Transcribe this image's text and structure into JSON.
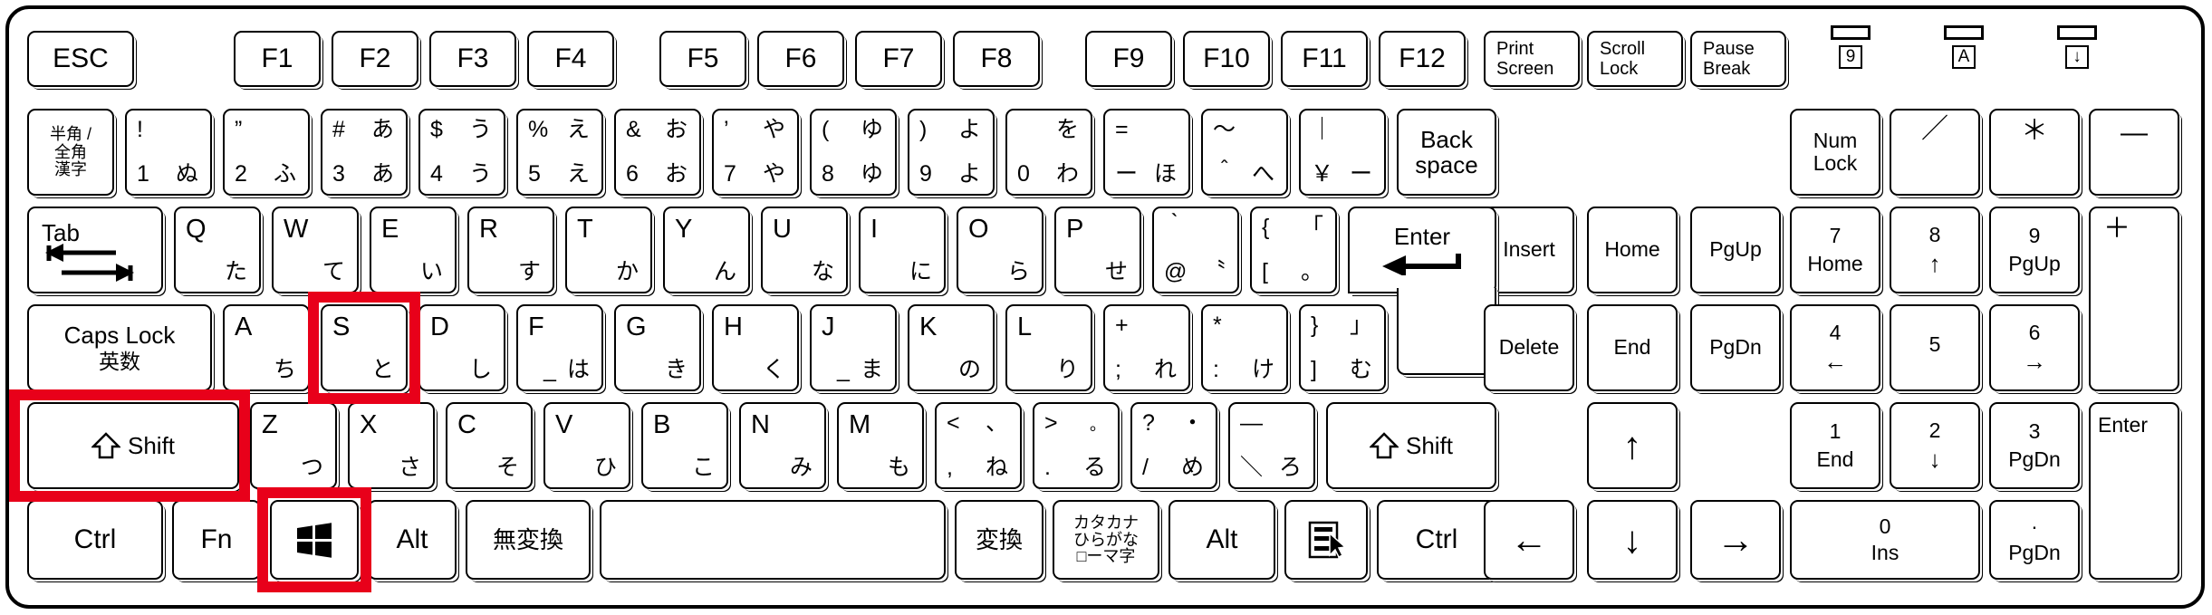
{
  "device": {
    "type": "japanese-jis-full-size-keyboard",
    "highlight_color": "#e8001a",
    "highlighted_keys": [
      "S",
      "Shift (left)",
      "Windows"
    ]
  },
  "indicators": [
    {
      "name": "num-lock-led",
      "label": "9"
    },
    {
      "name": "caps-lock-led",
      "label": "A"
    },
    {
      "name": "scroll-lock-led",
      "label": "↓"
    }
  ],
  "function_row": {
    "esc": "ESC",
    "f_keys": [
      "F1",
      "F2",
      "F3",
      "F4",
      "F5",
      "F6",
      "F7",
      "F8",
      "F9",
      "F10",
      "F11",
      "F12"
    ],
    "system": [
      {
        "line1": "Print",
        "line2": "Screen"
      },
      {
        "line1": "Scroll",
        "line2": "Lock"
      },
      {
        "line1": "Pause",
        "line2": "Break"
      }
    ]
  },
  "number_row": {
    "hankaku": {
      "l1": "半角 /",
      "l2": "全角",
      "l3": "漢字"
    },
    "keys": [
      {
        "tl": "!",
        "tr": "",
        "bl": "1",
        "br": "ぬ"
      },
      {
        "tl": "”",
        "tr": "",
        "bl": "2",
        "br": "ふ"
      },
      {
        "tl": "#",
        "tr": "あ",
        "bl": "3",
        "br": "あ"
      },
      {
        "tl": "$",
        "tr": "う",
        "bl": "4",
        "br": "う"
      },
      {
        "tl": "%",
        "tr": "え",
        "bl": "5",
        "br": "え"
      },
      {
        "tl": "&",
        "tr": "お",
        "bl": "6",
        "br": "お"
      },
      {
        "tl": "’",
        "tr": "や",
        "bl": "7",
        "br": "や"
      },
      {
        "tl": "(",
        "tr": "ゆ",
        "bl": "8",
        "br": "ゆ"
      },
      {
        "tl": ")",
        "tr": "よ",
        "bl": "9",
        "br": "よ"
      },
      {
        "tl": "",
        "tr": "を",
        "bl": "0",
        "br": "わ"
      },
      {
        "tl": "=",
        "tr": "",
        "bl": "ー",
        "br": "ほ"
      },
      {
        "tl": "～",
        "tr": "",
        "bl": "＾",
        "br": "へ"
      },
      {
        "tl": "｜",
        "tr": "",
        "bl": "￥",
        "br": "ー"
      }
    ],
    "backspace": {
      "line1": "Back",
      "line2": "space"
    }
  },
  "qwerty_row": {
    "tab": "Tab",
    "keys": [
      {
        "top": "Q",
        "jp": "た"
      },
      {
        "top": "W",
        "jp": "て"
      },
      {
        "top": "E",
        "jp": "い"
      },
      {
        "top": "R",
        "jp": "す"
      },
      {
        "top": "T",
        "jp": "か"
      },
      {
        "top": "Y",
        "jp": "ん"
      },
      {
        "top": "U",
        "jp": "な"
      },
      {
        "top": "I",
        "jp": "に"
      },
      {
        "top": "O",
        "jp": "ら"
      },
      {
        "top": "P",
        "jp": "せ"
      }
    ],
    "at_key": {
      "tl": "｀",
      "tr": "",
      "bl": "@",
      "br": "〝"
    },
    "bracket_key": {
      "tl": "{",
      "tr": "「",
      "bl": "[",
      "br": "。"
    },
    "enter": "Enter"
  },
  "home_row": {
    "caps": {
      "line1": "Caps Lock",
      "line2": "英数"
    },
    "keys": [
      {
        "top": "A",
        "jp": "ち"
      },
      {
        "top": "S",
        "jp": "と"
      },
      {
        "top": "D",
        "jp": "し"
      },
      {
        "top": "F",
        "jp": "は",
        "sub": "_"
      },
      {
        "top": "G",
        "jp": "き"
      },
      {
        "top": "H",
        "jp": "く"
      },
      {
        "top": "J",
        "jp": "ま",
        "sub": "_"
      },
      {
        "top": "K",
        "jp": "の"
      },
      {
        "top": "L",
        "jp": "り"
      }
    ],
    "semicolon": {
      "tl": "+",
      "tr": "",
      "bl": ";",
      "br": "れ"
    },
    "colon": {
      "tl": "*",
      "tr": "",
      "bl": ":",
      "br": "け"
    },
    "rbracket": {
      "tl": "}",
      "tr": "」",
      "bl": "]",
      "br": "む"
    }
  },
  "bottom_letter_row": {
    "shift_left": "Shift",
    "keys": [
      {
        "top": "Z",
        "jp": "つ"
      },
      {
        "top": "X",
        "jp": "さ"
      },
      {
        "top": "C",
        "jp": "そ"
      },
      {
        "top": "V",
        "jp": "ひ"
      },
      {
        "top": "B",
        "jp": "こ"
      },
      {
        "top": "N",
        "jp": "み"
      },
      {
        "top": "M",
        "jp": "も"
      }
    ],
    "comma": {
      "tl": "<",
      "tr": "、",
      "bl": ",",
      "br": "ね"
    },
    "period": {
      "tl": ">",
      "tr": "。",
      "bl": ".",
      "br": "る"
    },
    "slash": {
      "tl": "?",
      "tr": "・",
      "bl": "/",
      "br": "め"
    },
    "backslash": {
      "tl": "―",
      "tr": "",
      "bl": "＼",
      "br": "ろ"
    },
    "shift_right": "Shift"
  },
  "modifier_row": {
    "ctrl_left": "Ctrl",
    "fn": "Fn",
    "windows": "windows-logo",
    "alt_left": "Alt",
    "muhenkan": "無変換",
    "space": "",
    "henkan": "変換",
    "kana": {
      "l1": "カタカナ",
      "l2": "ひらがな",
      "l3": "□ーマ字"
    },
    "alt_right": "Alt",
    "menu": "context-menu-icon",
    "ctrl_right": "Ctrl"
  },
  "nav_cluster": {
    "row1": [
      "Insert",
      "Home",
      "PgUp"
    ],
    "row2": [
      "Delete",
      "End",
      "PgDn"
    ],
    "arrows": {
      "up": "↑",
      "left": "←",
      "down": "↓",
      "right": "→"
    }
  },
  "numpad": {
    "numlock": {
      "line1": "Num",
      "line2": "Lock"
    },
    "divide": "／",
    "multiply": "＊",
    "minus": "—",
    "plus": "＋",
    "enter": "Enter",
    "keys": [
      {
        "num": "7",
        "sub": "Home"
      },
      {
        "num": "8",
        "sub": "↑"
      },
      {
        "num": "9",
        "sub": "PgUp"
      },
      {
        "num": "4",
        "sub": "←"
      },
      {
        "num": "5",
        "sub": ""
      },
      {
        "num": "6",
        "sub": "→"
      },
      {
        "num": "1",
        "sub": "End"
      },
      {
        "num": "2",
        "sub": "↓"
      },
      {
        "num": "3",
        "sub": "PgDn"
      },
      {
        "num": "0",
        "sub": "Ins"
      },
      {
        "num": "·",
        "sub": "PgDn"
      }
    ]
  }
}
